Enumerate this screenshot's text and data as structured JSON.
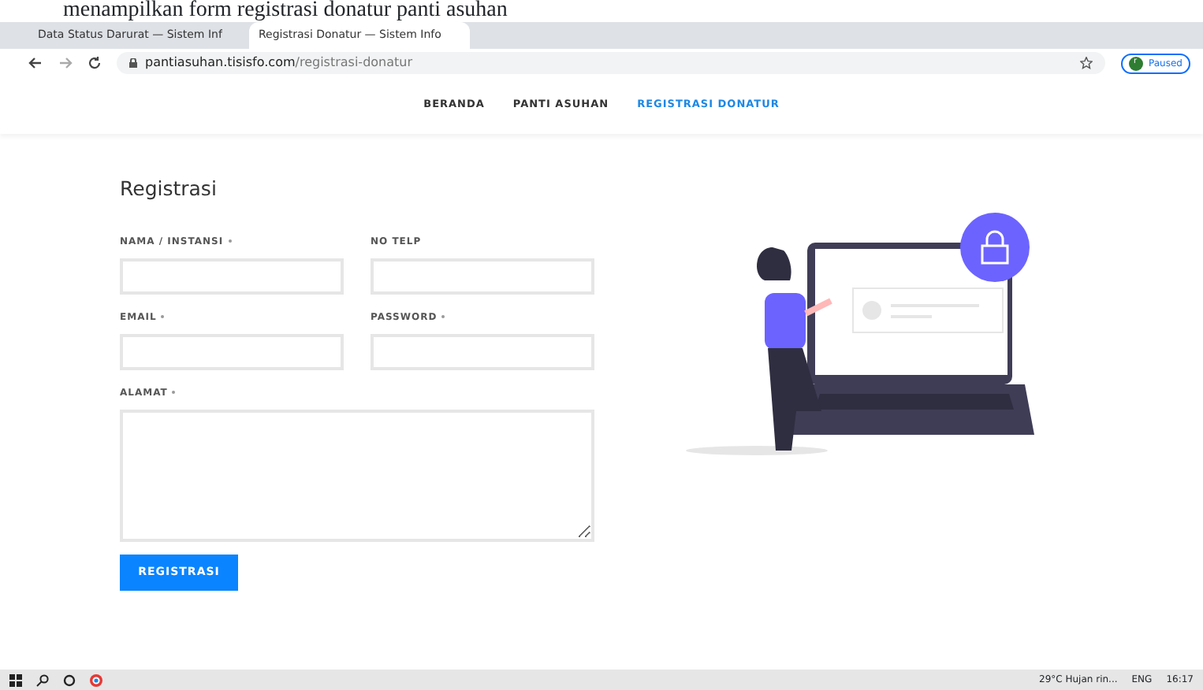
{
  "caption": "menampilkan form registrasi donatur panti asuhan",
  "browser": {
    "tabs": [
      {
        "title": "Data Status Darurat — Sistem Inf",
        "selected": false
      },
      {
        "title": "Registrasi Donatur — Sistem Info",
        "selected": true
      }
    ],
    "url_host": "pantiasuhan.tisisfo.com",
    "url_path": "/registrasi-donatur",
    "profile_initial": "r",
    "profile_status": "Paused"
  },
  "nav": [
    {
      "label": "BERANDA",
      "selected": false
    },
    {
      "label": "PANTI ASUHAN",
      "selected": false
    },
    {
      "label": "REGISTRASI DONATUR",
      "selected": true
    }
  ],
  "form": {
    "title": "Registrasi",
    "fields": [
      {
        "label": "NAMA / INSTANSI",
        "required": true,
        "kind": "input"
      },
      {
        "label": "NO TELP",
        "required": false,
        "kind": "input"
      },
      {
        "label": "EMAIL",
        "required": true,
        "kind": "input"
      },
      {
        "label": "PASSWORD",
        "required": true,
        "kind": "input"
      },
      {
        "label": "ALAMAT",
        "required": true,
        "kind": "textarea"
      }
    ],
    "submit": "REGISTRASI"
  },
  "taskbar": {
    "weather": "29°C  Hujan rin...",
    "language": "ENG",
    "time": "16:17"
  }
}
